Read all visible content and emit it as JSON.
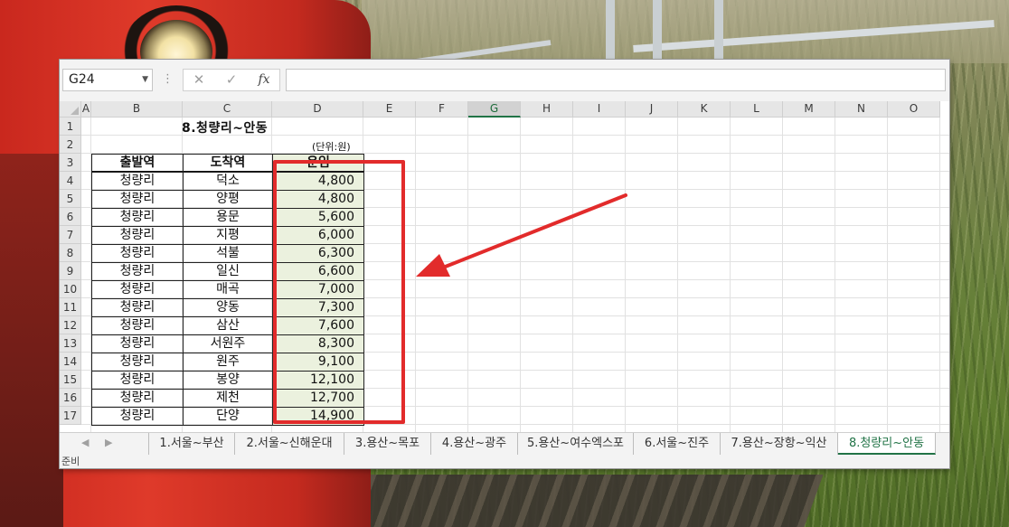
{
  "formula_bar": {
    "name_box": "G24",
    "dots": "⋮",
    "cancel_glyph": "✕",
    "enter_glyph": "✓",
    "fx_glyph": "fx",
    "value": ""
  },
  "columns": [
    "A",
    "B",
    "C",
    "D",
    "E",
    "F",
    "G",
    "H",
    "I",
    "J",
    "K",
    "L",
    "M",
    "N",
    "O"
  ],
  "selected_column": "G",
  "rows": [
    "1",
    "2",
    "3",
    "4",
    "5",
    "6",
    "7",
    "8",
    "9",
    "10",
    "11",
    "12",
    "13",
    "14",
    "15",
    "16",
    "17"
  ],
  "sheet": {
    "title": "8.청량리~안동",
    "unit": "(단위:원)",
    "headers": [
      "출발역",
      "도착역",
      "운임"
    ],
    "table": [
      {
        "from": "청량리",
        "to": "덕소",
        "fare": "4,800"
      },
      {
        "from": "청량리",
        "to": "양평",
        "fare": "4,800"
      },
      {
        "from": "청량리",
        "to": "용문",
        "fare": "5,600"
      },
      {
        "from": "청량리",
        "to": "지평",
        "fare": "6,000"
      },
      {
        "from": "청량리",
        "to": "석불",
        "fare": "6,300"
      },
      {
        "from": "청량리",
        "to": "일신",
        "fare": "6,600"
      },
      {
        "from": "청량리",
        "to": "매곡",
        "fare": "7,000"
      },
      {
        "from": "청량리",
        "to": "양동",
        "fare": "7,300"
      },
      {
        "from": "청량리",
        "to": "삼산",
        "fare": "7,600"
      },
      {
        "from": "청량리",
        "to": "서원주",
        "fare": "8,300"
      },
      {
        "from": "청량리",
        "to": "원주",
        "fare": "9,100"
      },
      {
        "from": "청량리",
        "to": "봉양",
        "fare": "12,100"
      },
      {
        "from": "청량리",
        "to": "제천",
        "fare": "12,700"
      },
      {
        "from": "청량리",
        "to": "단양",
        "fare": "14,900"
      }
    ]
  },
  "tabs": {
    "nav_prev": "◀",
    "nav_next": "▶",
    "items": [
      "1.서울~부산",
      "2.서울~신해운대",
      "3.용산~목포",
      "4.용산~광주",
      "5.용산~여수엑스포",
      "6.서울~진주",
      "7.용산~장항~익산",
      "8.청량리~안동"
    ],
    "active_index": 7
  },
  "status": {
    "text": "준비"
  },
  "annotation": {
    "color": "#e22b2b"
  }
}
